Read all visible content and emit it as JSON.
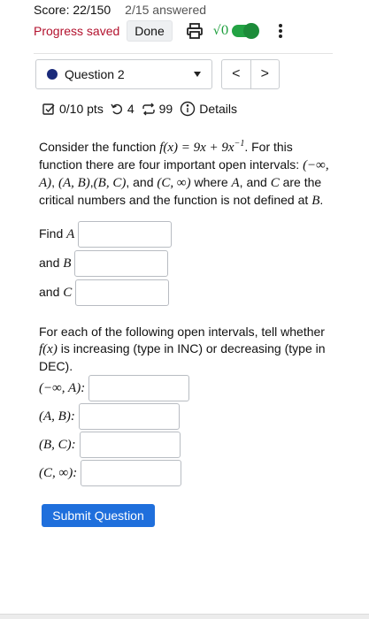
{
  "header": {
    "score": "Score: 22/150",
    "answered": "2/15 answered",
    "progress_saved": "Progress saved",
    "done_label": "Done",
    "sqrt_label": "√0",
    "accent_color": "#b3122e",
    "toggle_color": "#23a344"
  },
  "question_nav": {
    "selected": "Question 2",
    "prev": "<",
    "next": ">"
  },
  "meta": {
    "points": "0/10 pts",
    "retries": "4",
    "attempts": "99",
    "details": "Details"
  },
  "question": {
    "intro_1": "Consider the function ",
    "func": "f(x) = 9x + 9x",
    "func_exp": "−1",
    "intro_2": ". For this function there are four important open intervals: ",
    "interval_1": "(−∞, A)",
    "sep_1": ", ",
    "interval_2": "(A, B)",
    "sep_2": ",",
    "interval_3": "(B, C)",
    "sep_3": ", and ",
    "interval_4": "(C, ∞)",
    "intro_3": " where ",
    "var_a": "A",
    "intro_4": ", and ",
    "var_c": "C",
    "intro_5": " are the critical numbers and the function is not defined at ",
    "var_b": "B",
    "intro_6": "."
  },
  "fields": {
    "find_a_label": "Find ",
    "find_a_var": "A",
    "and_b_label": "and ",
    "and_b_var": "B",
    "and_c_label": "and ",
    "and_c_var": "C",
    "value_a": "",
    "value_b": "",
    "value_c": ""
  },
  "intervals": {
    "intro_1": "For each of the following open intervals, tell whether ",
    "func": "f(x)",
    "intro_2": " is increasing (type in INC) or decreasing (type in DEC).",
    "label_1": "(−∞, A):",
    "label_2": "(A, B):",
    "label_3": "(B, C):",
    "label_4": "(C, ∞):",
    "value_1": "",
    "value_2": "",
    "value_3": "",
    "value_4": ""
  },
  "submit_label": "Submit Question"
}
